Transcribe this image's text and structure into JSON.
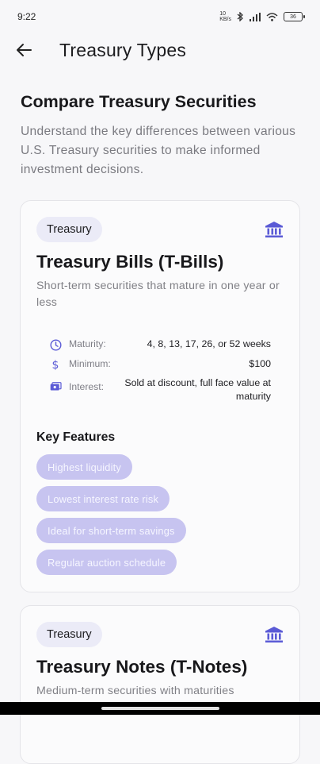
{
  "status_bar": {
    "time": "9:22",
    "battery": "36"
  },
  "app_bar": {
    "title": "Treasury Types"
  },
  "intro": {
    "heading": "Compare Treasury Securities",
    "description": "Understand the key differences between various U.S. Treasury securities to make informed investment decisions."
  },
  "cards": [
    {
      "badge": "Treasury",
      "title": "Treasury Bills (T-Bills)",
      "description": "Short-term securities that mature in one year or less",
      "details": [
        {
          "label": "Maturity:",
          "value": "4, 8, 13, 17, 26, or 52 weeks",
          "icon": "clock-icon"
        },
        {
          "label": "Minimum:",
          "value": "$100",
          "icon": "dollar-icon"
        },
        {
          "label": "Interest:",
          "value": "Sold at discount, full face value at maturity",
          "icon": "money-icon"
        }
      ],
      "features_heading": "Key Features",
      "features": [
        "Highest liquidity",
        "Lowest interest rate risk",
        "Ideal for short-term savings",
        "Regular auction schedule"
      ]
    },
    {
      "badge": "Treasury",
      "title": "Treasury Notes (T-Notes)",
      "description": "Medium-term securities with maturities"
    }
  ],
  "colors": {
    "accent": "#5b5bd6",
    "chip_bg": "#c7c4f0",
    "badge_bg": "#ebebf7"
  }
}
